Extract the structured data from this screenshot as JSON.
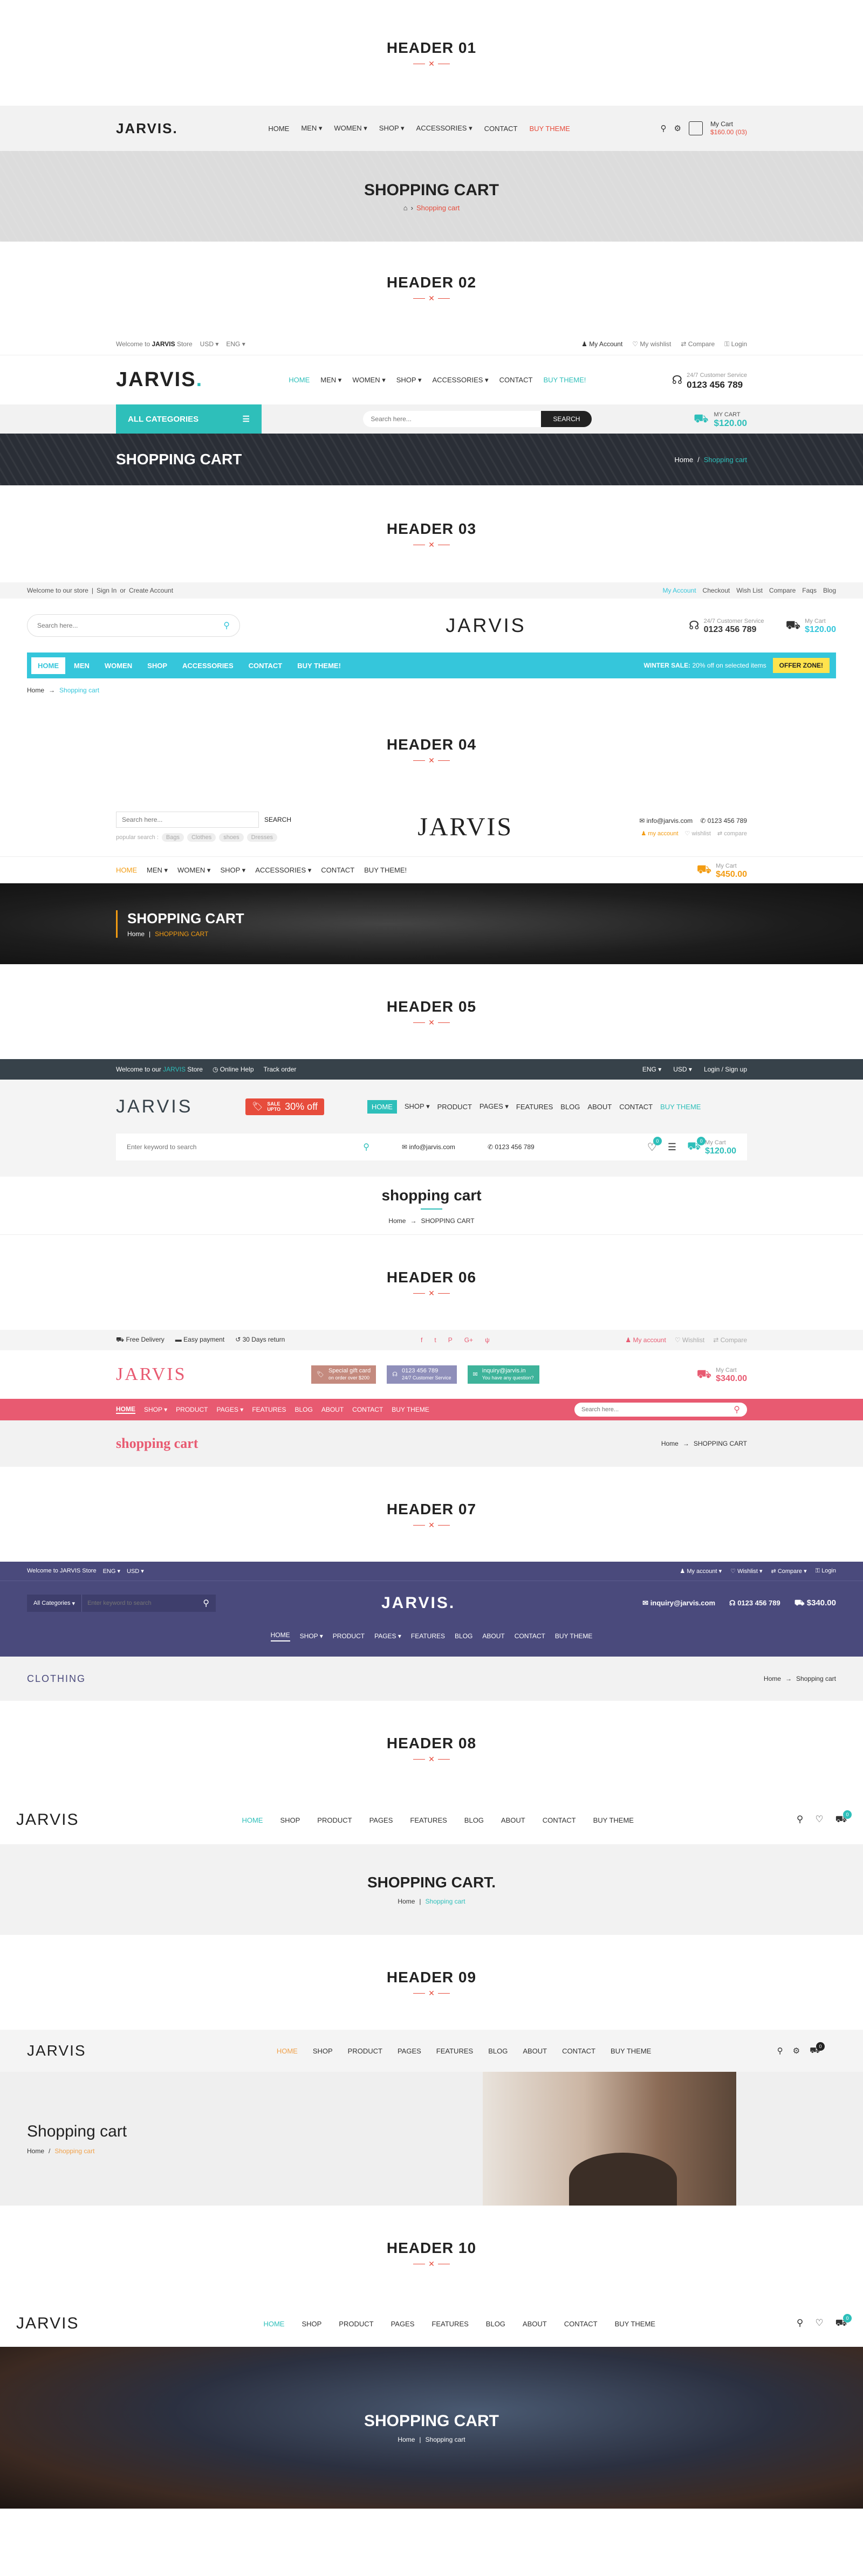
{
  "headings": [
    "HEADER 01",
    "HEADER 02",
    "HEADER 03",
    "HEADER 04",
    "HEADER 05",
    "HEADER 06",
    "HEADER 07",
    "HEADER 08",
    "HEADER 09",
    "HEADER 10"
  ],
  "colors": {
    "accent_red": "#e74c3c",
    "teal": "#2ebfba",
    "cyan_nav": "#35c6db",
    "pink": "#e85a71",
    "navy": "#4a4a7c",
    "dark_bar": "#37424a",
    "orange": "#f39c12"
  },
  "h1": {
    "logo": "JARVIS.",
    "nav": [
      "HOME",
      "MEN",
      "WOMEN",
      "SHOP",
      "ACCESSORIES",
      "CONTACT",
      "BUY THEME"
    ],
    "cart_label": "My Cart",
    "cart_total": "$160.00 (03)",
    "banner_title": "SHOPPING CART",
    "crumb_sep": "›",
    "crumb_current": "Shopping cart"
  },
  "h2": {
    "welcome_pre": "Welcome to",
    "welcome_brand": "JARVIS",
    "welcome_post": "Store",
    "currency": "USD",
    "lang": "ENG",
    "links": [
      "My Account",
      "My wishlist",
      "Compare",
      "Login"
    ],
    "logo": "JARVIS",
    "nav": [
      "HOME",
      "MEN",
      "WOMEN",
      "SHOP",
      "ACCESSORIES",
      "CONTACT",
      "BUY THEME!"
    ],
    "support_label": "24/7 Customer Service",
    "phone": "0123 456 789",
    "all_categories": "ALL CATEGORIES",
    "search_placeholder": "Search here...",
    "search_btn": "SEARCH",
    "cart_label": "MY CART",
    "cart_total": "$120.00",
    "banner_title": "SHOPPING CART",
    "crumb_home": "Home",
    "crumb_sep": "/",
    "crumb_current": "Shopping cart"
  },
  "h3": {
    "welcome": "Welcome to our store",
    "sign_in": "Sign In",
    "or": "or",
    "create": "Create Account",
    "links": [
      "My Account",
      "Checkout",
      "Wish List",
      "Compare",
      "Faqs",
      "Blog"
    ],
    "search_placeholder": "Search here...",
    "logo": "JARVIS",
    "support_label": "24/7 Customer Service",
    "phone": "0123 456 789",
    "cart_label": "My Cart",
    "cart_total": "$120.00",
    "nav": [
      "HOME",
      "MEN",
      "WOMEN",
      "SHOP",
      "ACCESSORIES",
      "CONTACT",
      "BUY THEME!"
    ],
    "promo_bold": "WINTER SALE:",
    "promo_text": "20% off on selected items",
    "offer_btn": "OFFER ZONE!",
    "crumb_home": "Home",
    "crumb_sep": "→",
    "crumb_current": "Shopping cart"
  },
  "h4": {
    "search_placeholder": "Search here...",
    "search_btn": "SEARCH",
    "popular_label": "popular search :",
    "tags": [
      "Bags",
      "Clothes",
      "shoes",
      "Dresses"
    ],
    "logo": "JARVIS",
    "email": "info@jarvis.com",
    "phone": "0123 456 789",
    "links": [
      "my account",
      "wishlist",
      "compare"
    ],
    "nav": [
      "HOME",
      "MEN",
      "WOMEN",
      "SHOP",
      "ACCESSORIES",
      "CONTACT",
      "BUY THEME!"
    ],
    "cart_label": "My Cart",
    "cart_total": "$450.00",
    "banner_title": "SHOPPING CART",
    "crumb_home": "Home",
    "crumb_sep": "|",
    "crumb_current": "SHOPPING CART"
  },
  "h5": {
    "welcome_pre": "Welcome to our",
    "welcome_brand": "JARVIS",
    "welcome_post": "Store",
    "online_help": "Online Help",
    "track": "Track order",
    "lang": "ENG",
    "currency": "USD",
    "login": "Login / Sign up",
    "logo": "JARVIS",
    "sale_word": "SALE",
    "sale_sub": "UPTO",
    "sale_pct": "30% off",
    "nav": [
      "HOME",
      "SHOP",
      "PRODUCT",
      "PAGES",
      "FEATURES",
      "BLOG",
      "ABOUT",
      "CONTACT",
      "BUY THEME"
    ],
    "search_placeholder": "Enter keyword to search",
    "email": "info@jarvis.com",
    "phone": "0123 456 789",
    "wish_count": "0",
    "cart_count": "0",
    "cart_label": "My Cart",
    "cart_total": "$120.00",
    "banner_title": "shopping cart",
    "crumb_home": "Home",
    "crumb_sep": "→",
    "crumb_current": "SHOPPING CART"
  },
  "h6": {
    "features": [
      "Free Delivery",
      "Easy payment",
      "30 Days return"
    ],
    "socials": [
      "f",
      "t",
      "P",
      "G+",
      "ψ"
    ],
    "links": [
      "My account",
      "Wishlist",
      "Compare"
    ],
    "logo": "JARVIS",
    "promos": [
      {
        "t1": "Special gift card",
        "t2": "on order over $200"
      },
      {
        "t1": "0123 456 789",
        "t2": "24/7 Customer Service"
      },
      {
        "t1": "inquiry@jarvis.in",
        "t2": "You have any question?"
      }
    ],
    "cart_label": "My Cart",
    "cart_total": "$340.00",
    "nav": [
      "HOME",
      "SHOP",
      "PRODUCT",
      "PAGES",
      "FEATURES",
      "BLOG",
      "ABOUT",
      "CONTACT",
      "BUY THEME"
    ],
    "search_placeholder": "Search here...",
    "banner_title": "shopping cart",
    "crumb_home": "Home",
    "crumb_sep": "→",
    "crumb_current": "SHOPPING CART"
  },
  "h7": {
    "welcome": "Welcome to JARVIS Store",
    "lang": "ENG",
    "currency": "USD",
    "links": [
      "My account",
      "Wishlist",
      "Compare",
      "Login"
    ],
    "category": "All Categories",
    "search_placeholder": "Enter keyword to search",
    "logo": "JARVIS.",
    "email": "inquiry@jarvis.com",
    "phone": "0123 456 789",
    "cart_total": "$340.00",
    "nav": [
      "HOME",
      "SHOP",
      "PRODUCT",
      "PAGES",
      "FEATURES",
      "BLOG",
      "ABOUT",
      "CONTACT",
      "BUY THEME"
    ],
    "banner_title": "CLOTHING",
    "crumb_home": "Home",
    "crumb_sep": "→",
    "crumb_current": "Shopping cart"
  },
  "h8": {
    "logo": "JARVIS",
    "nav": [
      "HOME",
      "SHOP",
      "PRODUCT",
      "PAGES",
      "FEATURES",
      "BLOG",
      "ABOUT",
      "CONTACT",
      "BUY THEME"
    ],
    "cart_count": "0",
    "banner_title": "SHOPPING CART.",
    "crumb_home": "Home",
    "crumb_sep": "|",
    "crumb_current": "Shopping cart"
  },
  "h9": {
    "logo": "JARVIS",
    "nav": [
      "HOME",
      "SHOP",
      "PRODUCT",
      "PAGES",
      "FEATURES",
      "BLOG",
      "ABOUT",
      "CONTACT",
      "BUY THEME"
    ],
    "cart_count": "0",
    "banner_title": "Shopping cart",
    "crumb_home": "Home",
    "crumb_sep": "/",
    "crumb_current": "Shopping cart"
  },
  "h10": {
    "logo": "JARVIS",
    "nav": [
      "HOME",
      "SHOP",
      "PRODUCT",
      "PAGES",
      "FEATURES",
      "BLOG",
      "ABOUT",
      "CONTACT",
      "BUY THEME"
    ],
    "cart_count": "0",
    "banner_title": "SHOPPING CART",
    "crumb_home": "Home",
    "crumb_sep": "|",
    "crumb_current": "Shopping cart"
  }
}
